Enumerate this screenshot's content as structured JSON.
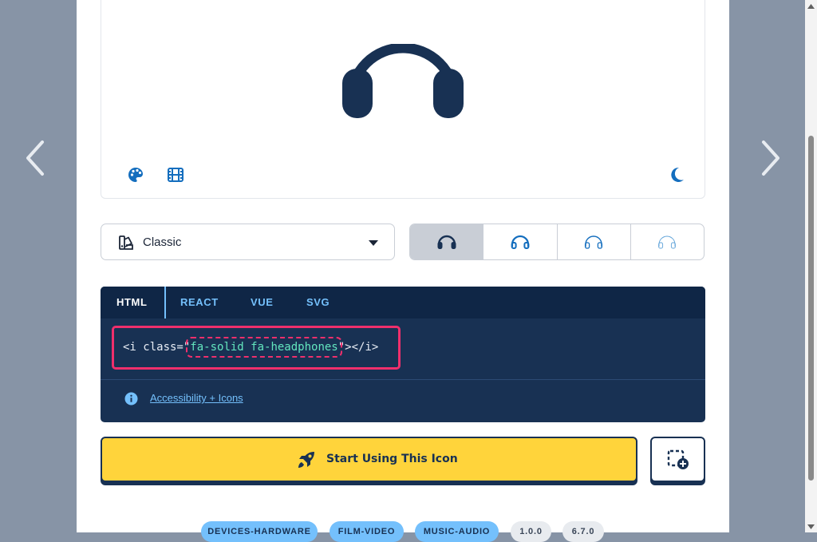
{
  "icon": {
    "name": "headphones",
    "color": "#183153"
  },
  "preview_tools": {
    "palette_icon": "palette-icon",
    "film_icon": "film-icon",
    "moon_icon": "moon-icon",
    "accent": "#146ebe"
  },
  "style_select": {
    "selected": "Classic",
    "icon": "calendar-icon",
    "caret": "caret-down-icon"
  },
  "family_options": [
    {
      "name": "solid",
      "selected": true
    },
    {
      "name": "regular",
      "selected": false
    },
    {
      "name": "light",
      "selected": false
    },
    {
      "name": "thin",
      "selected": false
    }
  ],
  "code": {
    "tabs": [
      "HTML",
      "REACT",
      "VUE",
      "SVG"
    ],
    "active_tab": "HTML",
    "snippet_prefix": "<i class=\"",
    "snippet_class": "fa-solid fa-headphones",
    "snippet_suffix": "\"></i>",
    "accessibility_link": "Accessibility + Icons"
  },
  "actions": {
    "start_label": "Start Using This Icon",
    "start_icon": "rocket-icon",
    "add_icon": "add-to-collection-icon"
  },
  "tags": [
    "DEVICES-HARDWARE",
    "FILM-VIDEO",
    "MUSIC-AUDIO",
    "1.0.0",
    "6.7.0"
  ],
  "colors": {
    "backdrop": "#8794a6",
    "navy": "#183153",
    "yellow": "#ffd43b",
    "highlight": "#ef2f6c",
    "code_text": "#63e6be",
    "tab_blue": "#74c0fc"
  }
}
